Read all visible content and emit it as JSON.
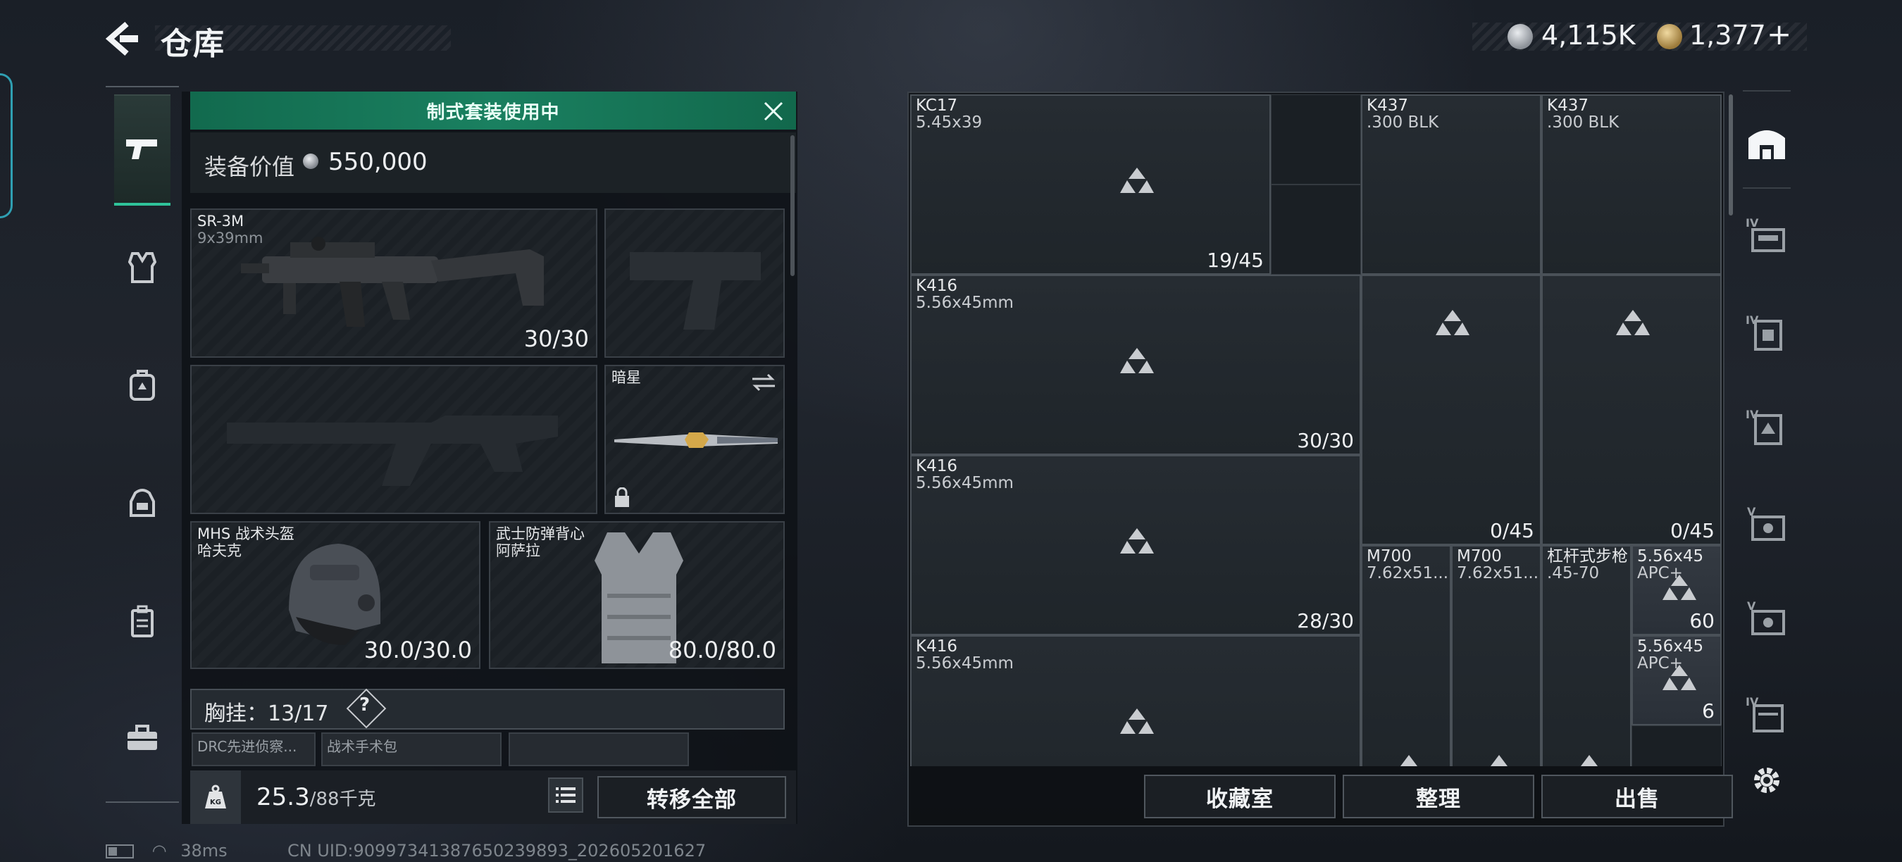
{
  "header": {
    "title": "仓库"
  },
  "currency": {
    "silver": "4,115K",
    "gold": "1,377",
    "gold_add": "+"
  },
  "loadout": {
    "banner": "制式套装使用中",
    "equip_value_label": "装备价值",
    "equip_value": "550,000",
    "primary": {
      "name": "SR-3M",
      "caliber": "9x39mm",
      "ammo": "30/30"
    },
    "melee": {
      "name": "暗星"
    },
    "helmet": {
      "name": "MHS 战术头盔",
      "sub": "哈夫克",
      "durability": "30.0/30.0"
    },
    "armor": {
      "name": "武士防弹背心",
      "sub": "阿萨拉",
      "durability": "80.0/80.0"
    },
    "chest": {
      "label": "胸挂",
      "count": "13/17",
      "help": "?"
    },
    "chest_items": [
      "DRC先进侦察...",
      "战术手术包"
    ],
    "weight": "25.3",
    "weight_max": "/88千克",
    "transfer_all": "转移全部"
  },
  "storage": {
    "items": [
      {
        "name": "KC17",
        "sub": "5.45x39",
        "count": "19/45"
      },
      {
        "name": "K437",
        "sub": ".300 BLK",
        "count": ""
      },
      {
        "name": "K437",
        "sub": ".300 BLK",
        "count": ""
      },
      {
        "name": "K416",
        "sub": "5.56x45mm",
        "count": "30/30"
      },
      {
        "name": "K416",
        "sub": "5.56x45mm",
        "count": "28/30"
      },
      {
        "name": "",
        "sub": "",
        "count": "0/45"
      },
      {
        "name": "",
        "sub": "",
        "count": "0/45"
      },
      {
        "name": "M700",
        "sub": "7.62x51...",
        "count": ""
      },
      {
        "name": "M700",
        "sub": "7.62x51...",
        "count": ""
      },
      {
        "name": "杠杆式步枪",
        "sub": ".45-70",
        "count": ""
      },
      {
        "name": "5.56x45",
        "sub": "APC+",
        "count": "60"
      },
      {
        "name": "K416",
        "sub": "5.56x45mm",
        "count": ""
      },
      {
        "name": "5.56x45",
        "sub": "APC+",
        "count": "6"
      }
    ],
    "buttons": {
      "collection": "收藏室",
      "organize": "整理",
      "sell": "出售"
    }
  },
  "status": {
    "ping": "38ms",
    "uid": "CN UID:909973413876502398​93_202605201627"
  },
  "colors": {
    "accent_green": "#1a8060",
    "active_tab": "#2fc39a"
  }
}
